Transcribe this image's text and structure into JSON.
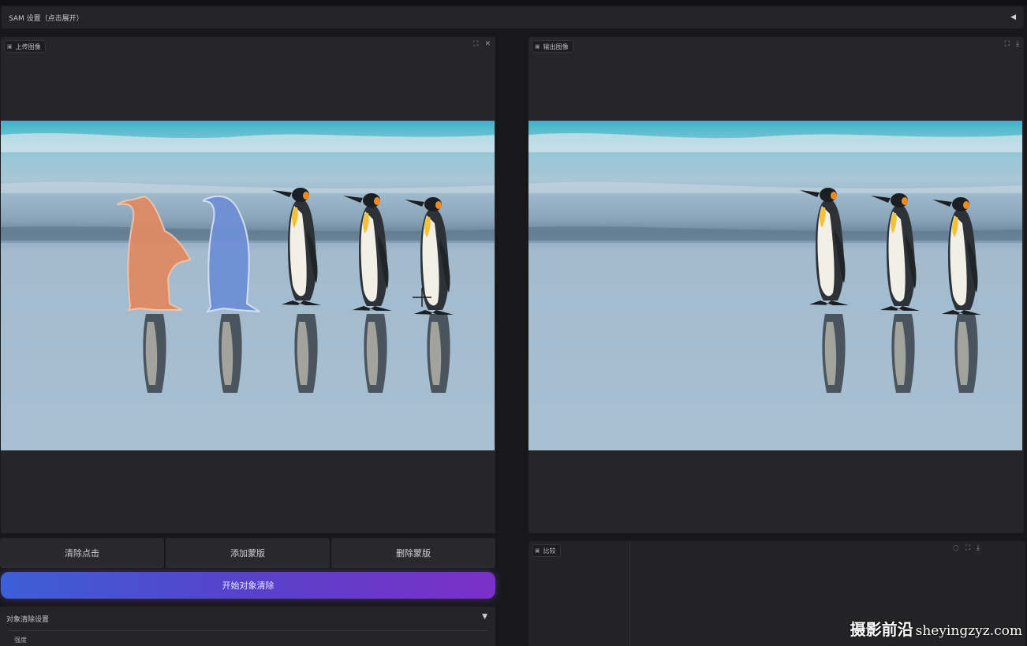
{
  "sam_settings": {
    "label": "SAM 设置（点击展开）",
    "caret": "◀"
  },
  "input_panel": {
    "label": "上传图像",
    "tools": [
      "⛶",
      "✕"
    ]
  },
  "output_panel": {
    "label": "输出图像",
    "tools": [
      "⛶",
      "⤓"
    ]
  },
  "compare_panel": {
    "label": "比较",
    "tools": [
      "◌",
      "⛶",
      "⤓"
    ]
  },
  "buttons": {
    "clear_clicks": "清除点击",
    "add_mask": "添加蒙版",
    "delete_mask": "删除蒙版"
  },
  "primary_button": "开始对象清除",
  "removal_settings": {
    "label": "对象清除设置",
    "caret": "▼",
    "first_field": "强度"
  },
  "watermark": {
    "cn": "摄影前沿",
    "en": "sheyingzyz.com"
  },
  "colors": {
    "mask_orange": "#e08a64",
    "mask_blue": "#6f8fd6",
    "accent_start": "#3c5fd6",
    "accent_end": "#7b2fc9"
  }
}
